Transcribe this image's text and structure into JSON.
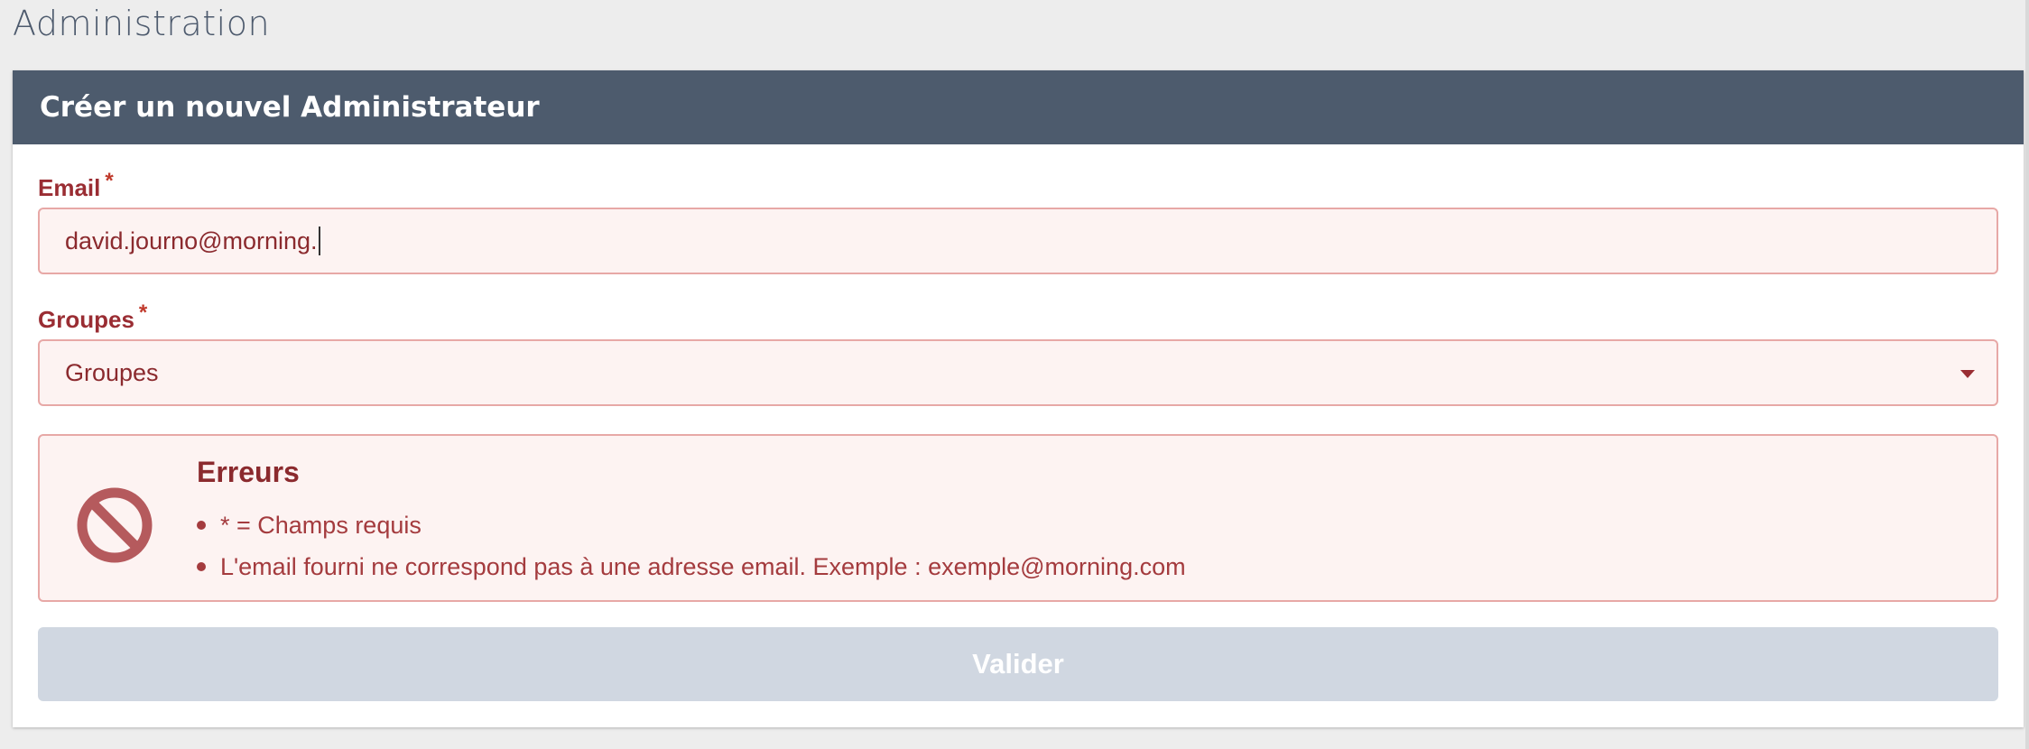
{
  "page": {
    "title": "Administration"
  },
  "form": {
    "header": "Créer un nouvel Administrateur",
    "email": {
      "label": "Email",
      "required_mark": "*",
      "value": "david.journo@morning."
    },
    "groups": {
      "label": "Groupes",
      "required_mark": "*",
      "selected": "Groupes"
    },
    "errors": {
      "title": "Erreurs",
      "icon": "prohibited-icon",
      "items": [
        "* = Champs requis",
        "L'email fourni ne correspond pas à une adresse email. Exemple : exemple@morning.com"
      ]
    },
    "submit_label": "Valider"
  },
  "colors": {
    "header_bg": "#4d5b6d",
    "error_text": "#9a2d33",
    "error_bg": "#fdf3f2",
    "error_border": "#e7a8a6",
    "button_disabled": "#d0d7e1"
  }
}
